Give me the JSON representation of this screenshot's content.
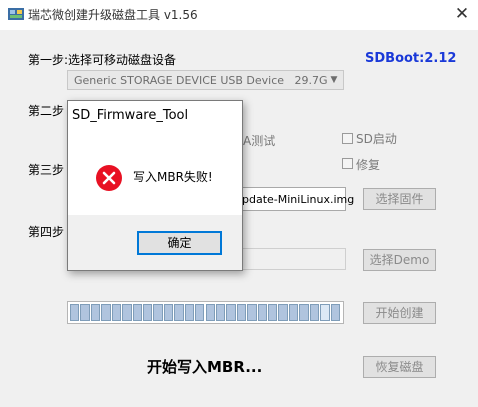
{
  "window": {
    "title": "瑞芯微创建升级磁盘工具 v1.56",
    "close_glyph": "✕"
  },
  "version_label": "SDBoot:2.12",
  "steps": {
    "step1_label": "第一步:选择可移动磁盘设备",
    "step2_label": "第二步",
    "step3_label": "第三步",
    "step4_label": "第四步"
  },
  "device_select": {
    "selected": "Generic STORAGE DEVICE USB Device",
    "size": "29.7G"
  },
  "options": {
    "mode_partial": "A测试",
    "sd_boot": "SD启动",
    "repair": "修复"
  },
  "firmware": {
    "path": "pdate-MiniLinux.img",
    "button": "选择固件"
  },
  "demo": {
    "path": "",
    "button": "选择Demo"
  },
  "progress": {
    "filled_segments": 26,
    "total_segments": 26,
    "highlight_index": 24
  },
  "create_button": "开始创建",
  "restore_button": "恢复磁盘",
  "status_text": "开始写入MBR...",
  "dialog": {
    "title": "SD_Firmware_Tool",
    "message": "写入MBR失败!",
    "ok_label": "确定",
    "icon": "error-icon"
  },
  "colors": {
    "accent": "#1a39d8",
    "error": "#e81123",
    "focus": "#0078d7",
    "progress": "#b0c4de"
  }
}
